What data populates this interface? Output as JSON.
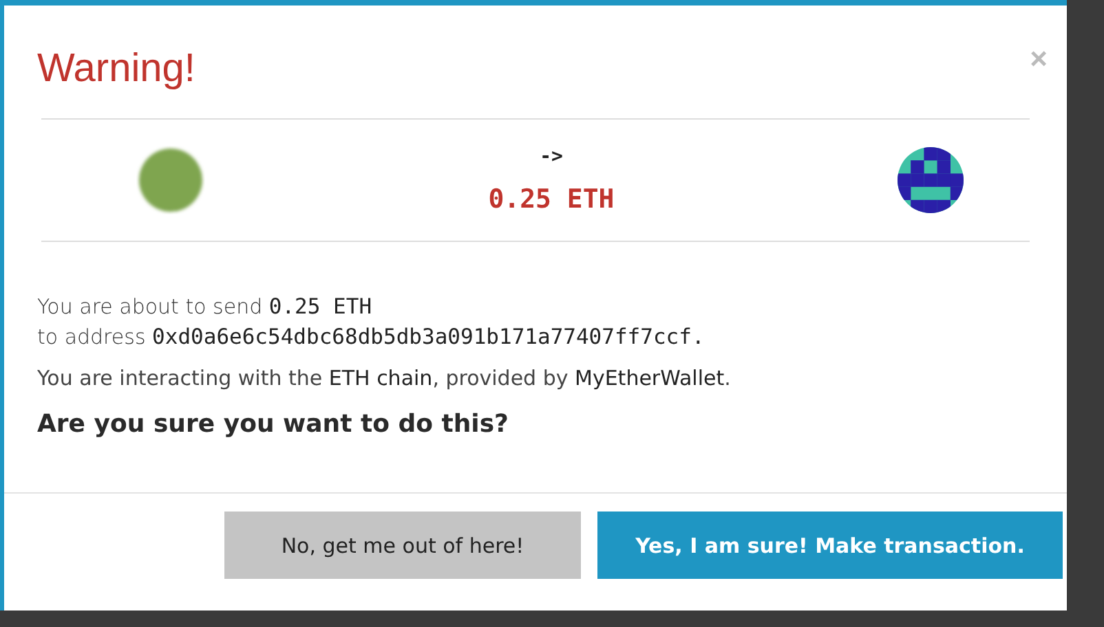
{
  "modal": {
    "title": "Warning!",
    "close": "×"
  },
  "transfer": {
    "arrow": "->",
    "amount": "0.25 ETH"
  },
  "message": {
    "send_prefix": "You are about to send ",
    "send_amount": "0.25 ETH",
    "address_prefix": "to address ",
    "address": "0xd0a6e6c54dbc68db5db3a091b171a77407ff7ccf.",
    "chain_note": "You are interacting with the **ETH chain**, provided by **MyEtherWallet**.",
    "question": "Are you sure you want to do this?"
  },
  "buttons": [
    {
      "label": "No, get me out of here!",
      "kind": "cancel"
    },
    {
      "label": "Yes, I am sure! Make transaction.",
      "kind": "confirm"
    }
  ]
}
